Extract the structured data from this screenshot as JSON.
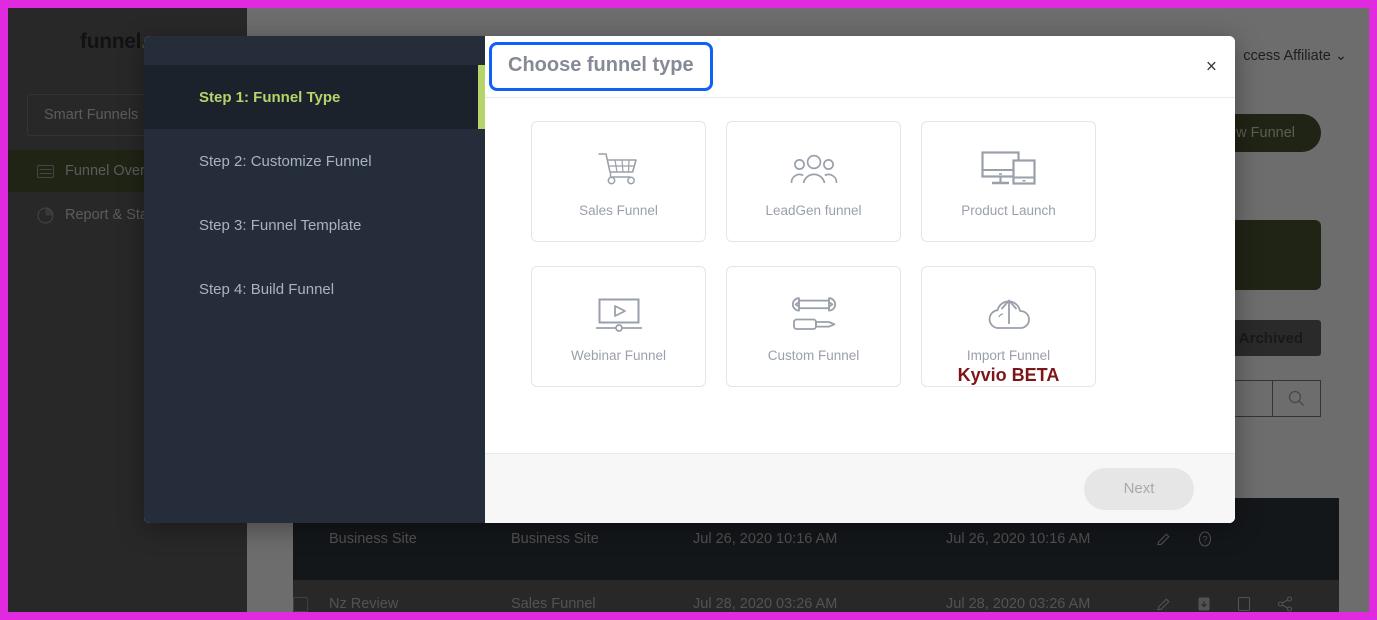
{
  "background": {
    "logo": "funnel",
    "project_select": "Smart Funnels",
    "nav": [
      {
        "label": "Funnel Overview",
        "icon": "dashboard-icon",
        "active": true
      },
      {
        "label": "Report & Stats",
        "icon": "pie-chart-icon",
        "active": false
      }
    ],
    "account_menu": "ccess Affiliate",
    "new_funnel_button": "w Funnel",
    "archived_tab": "Archived",
    "search_icon": "search-icon",
    "table": {
      "rows": [
        {
          "name": "Business Site",
          "type": "Business Site",
          "created": "Jul 26, 2020 10:16 AM",
          "modified": "Jul 26, 2020 10:16 AM",
          "actions": [
            "pencil-icon",
            "help-icon"
          ]
        },
        {
          "name": "Nz Review",
          "type": "Sales Funnel",
          "created": "Jul 28, 2020 03:26 AM",
          "modified": "Jul 28, 2020 03:26 AM",
          "actions": [
            "pencil-icon",
            "archive-icon",
            "copy-icon",
            "share-icon"
          ]
        }
      ]
    }
  },
  "modal": {
    "title": "Choose funnel type",
    "close_label": "×",
    "highlight_color": "#1160f5",
    "steps": [
      {
        "label": "Step 1: Funnel Type",
        "active": true
      },
      {
        "label": "Step 2: Customize Funnel",
        "active": false
      },
      {
        "label": "Step 3: Funnel Template",
        "active": false
      },
      {
        "label": "Step 4: Build Funnel",
        "active": false
      }
    ],
    "active_step_color": "#b5d46a",
    "funnel_types": [
      {
        "label": "Sales Funnel",
        "icon": "shopping-cart-icon",
        "sub": ""
      },
      {
        "label": "LeadGen funnel",
        "icon": "people-group-icon",
        "sub": ""
      },
      {
        "label": "Product Launch",
        "icon": "devices-icon",
        "sub": ""
      },
      {
        "label": "Webinar Funnel",
        "icon": "video-player-icon",
        "sub": ""
      },
      {
        "label": "Custom Funnel",
        "icon": "tools-icon",
        "sub": ""
      },
      {
        "label": "Import Funnel",
        "icon": "cloud-upload-icon",
        "sub": "Kyvio BETA"
      }
    ],
    "next_button": "Next",
    "next_enabled": false
  }
}
